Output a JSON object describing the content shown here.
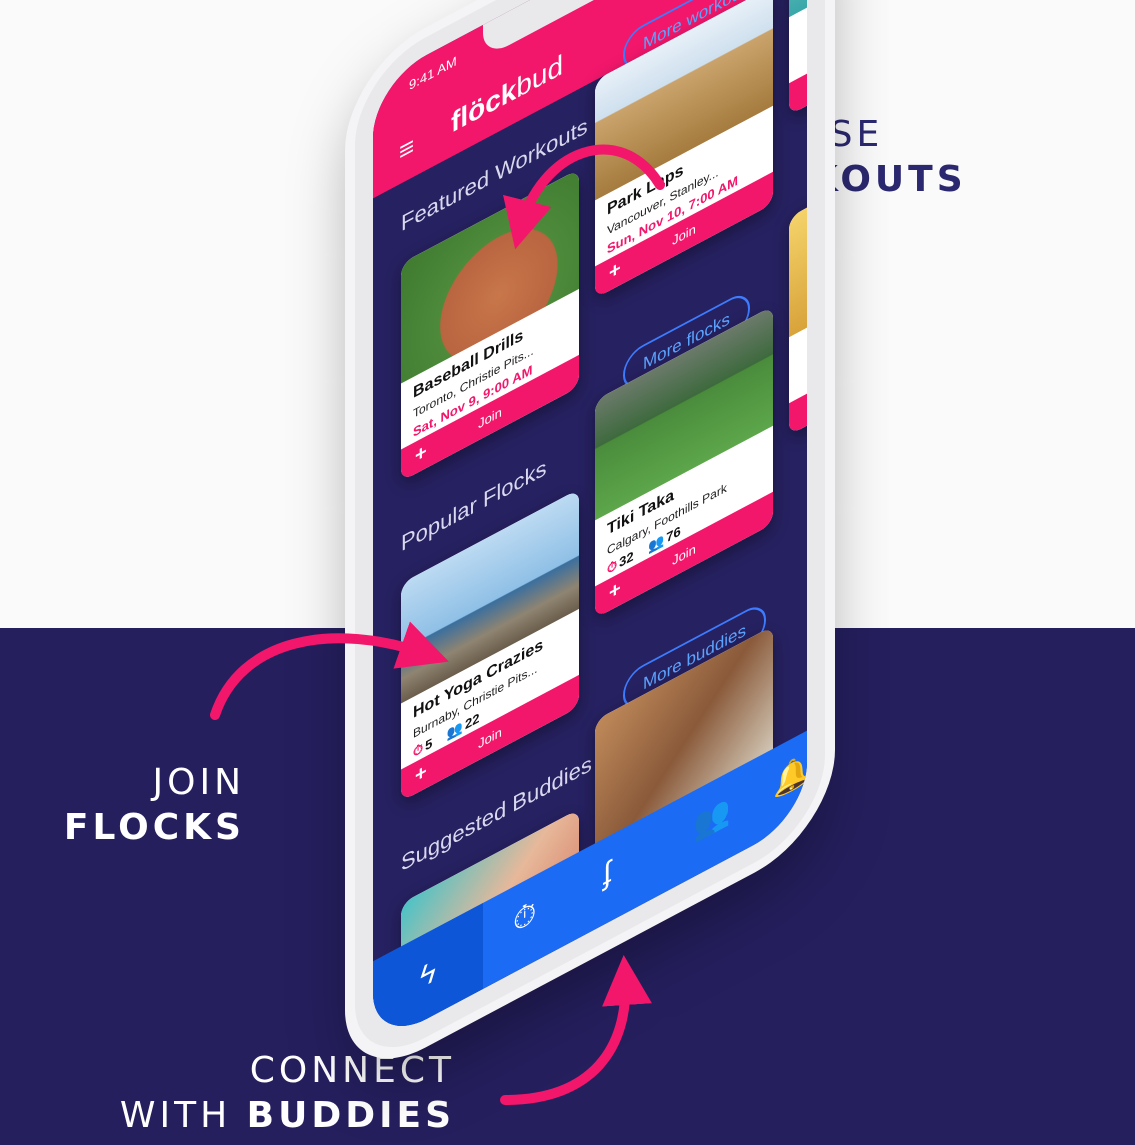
{
  "promo": {
    "browse": {
      "line1": "BROWSE",
      "line2": "WORKOUTS"
    },
    "join": {
      "line1": "JOIN",
      "line2": "FLOCKS"
    },
    "connect": {
      "line1": "CONNECT",
      "line2a": "WITH ",
      "line2b": "BUDDIES"
    }
  },
  "status": {
    "time": "9:41 AM",
    "icons": "signal-wifi-battery"
  },
  "app": {
    "logo_bold": "flöck",
    "logo_light": "bud",
    "menu_icon": "hamburger-icon"
  },
  "featured": {
    "title": "Featured Workouts",
    "more": "More workouts",
    "cards": [
      {
        "title": "Baseball Drills",
        "location": "Toronto, Christie Pits...",
        "date": "Sat, Nov 9, 9:00 AM",
        "join": "Join",
        "plus": "+"
      },
      {
        "title": "Park Laps",
        "location": "Vancouver, Stanley...",
        "date": "Sun, Nov 10, 7:00 AM",
        "join": "Join",
        "plus": "+"
      }
    ]
  },
  "flocks": {
    "title": "Popular Flocks",
    "more": "More flocks",
    "cards": [
      {
        "title": "Hot Yoga Crazies",
        "location": "Burnaby, Christie Pits...",
        "workouts": "5",
        "members": "22",
        "join": "Join",
        "plus": "+"
      },
      {
        "title": "Tiki Taka",
        "location": "Calgary, Foothills Park",
        "workouts": "32",
        "members": "76",
        "join": "Join",
        "plus": "+"
      }
    ]
  },
  "buddies": {
    "title": "Suggested Buddies",
    "more": "More buddies"
  },
  "tabs": [
    "bolt-icon",
    "stopwatch-icon",
    "flock-wing-icon",
    "buddies-icon",
    "bell-icon"
  ],
  "colors": {
    "brand_pink": "#f2176b",
    "navy": "#262160",
    "tab_blue": "#1b6bf5"
  }
}
